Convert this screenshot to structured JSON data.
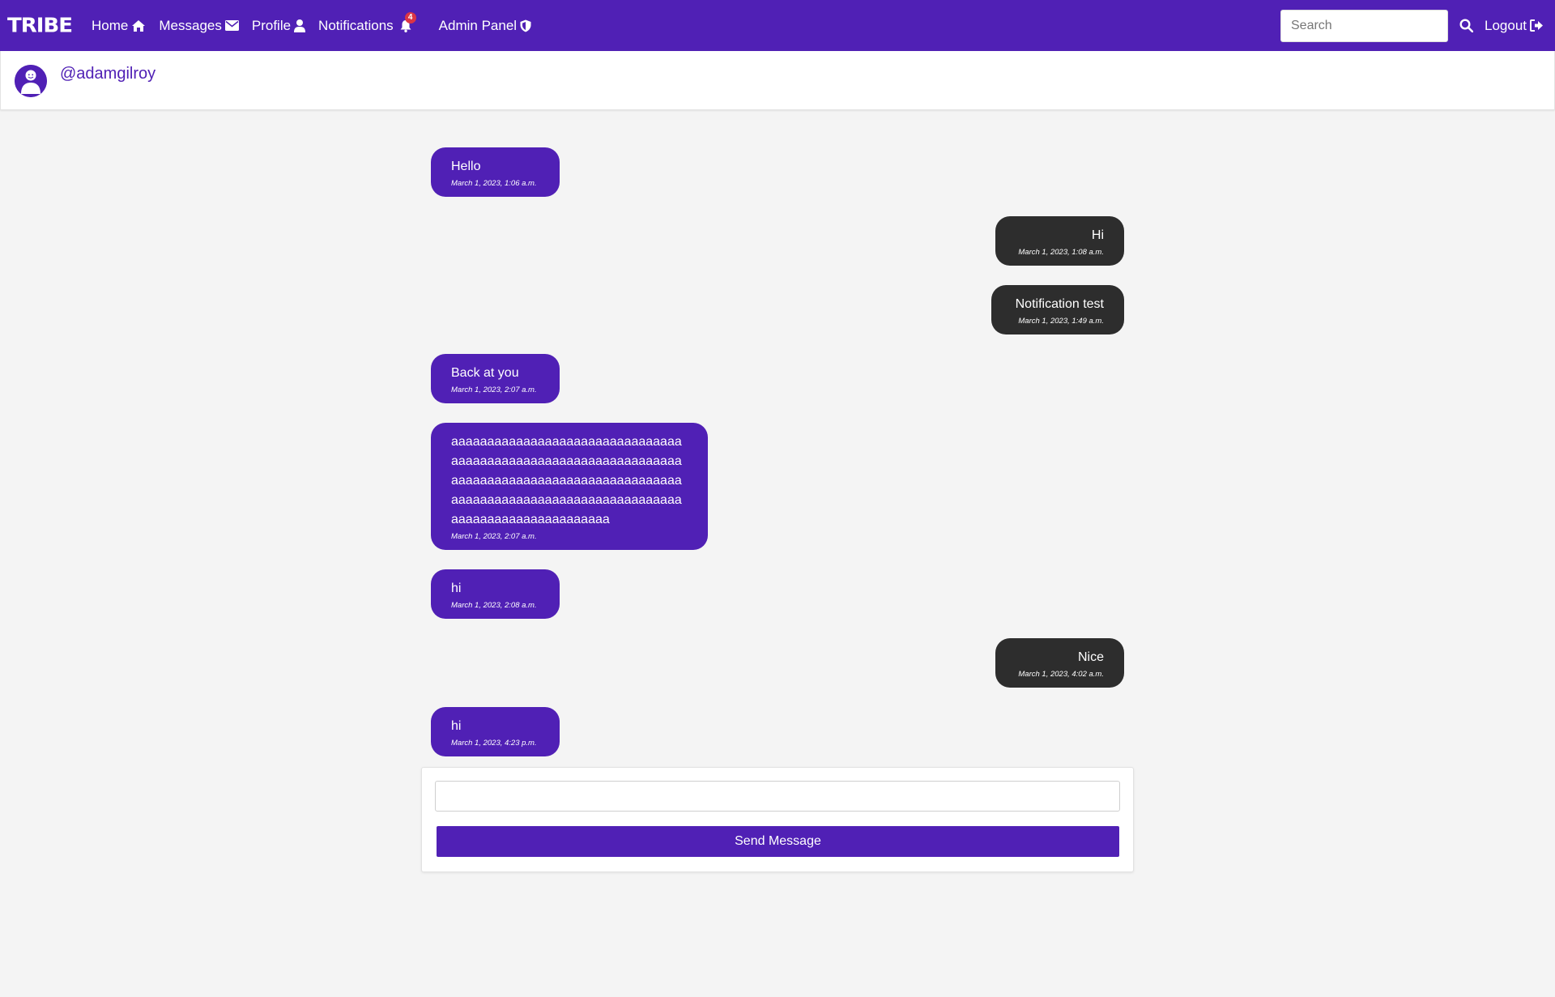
{
  "nav": {
    "brand": "TRIBE",
    "home": "Home",
    "messages": "Messages",
    "profile": "Profile",
    "notifications": "Notifications",
    "notification_count": "4",
    "admin": "Admin Panel",
    "search_placeholder": "Search",
    "logout": "Logout"
  },
  "chat": {
    "username": "@adamgilroy"
  },
  "messages": [
    {
      "direction": "in",
      "text": "Hello",
      "time": "March 1, 2023, 1:06 a.m."
    },
    {
      "direction": "out",
      "text": "Hi",
      "time": "March 1, 2023, 1:08 a.m."
    },
    {
      "direction": "out",
      "text": "Notification test",
      "time": "March 1, 2023, 1:49 a.m."
    },
    {
      "direction": "in",
      "text": "Back at you",
      "time": "March 1, 2023, 2:07 a.m."
    },
    {
      "direction": "in",
      "text": "aaaaaaaaaaaaaaaaaaaaaaaaaaaaaaaaaaaaaaaaaaaaaaaaaaaaaaaaaaaaaaaaaaaaaaaaaaaaaaaaaaaaaaaaaaaaaaaaaaaaaaaaaaaaaaaaaaaaaaaaaaaaaaaaaaaaaaaaaaaaaaaaaaaaaa",
      "time": "March 1, 2023, 2:07 a.m."
    },
    {
      "direction": "in",
      "text": "hi",
      "time": "March 1, 2023, 2:08 a.m."
    },
    {
      "direction": "out",
      "text": "Nice",
      "time": "March 1, 2023, 4:02 a.m."
    },
    {
      "direction": "in",
      "text": "hi",
      "time": "March 1, 2023, 4:23 p.m."
    }
  ],
  "composer": {
    "input_value": "",
    "send_label": "Send Message"
  },
  "colors": {
    "brand": "#5020b5",
    "outgoing_bubble": "#2d2d2d",
    "page_bg": "#f4f4f4",
    "badge": "#dc3545"
  },
  "icons": [
    "home-icon",
    "envelope-icon",
    "user-icon",
    "bell-icon",
    "shield-icon",
    "search-icon",
    "logout-icon"
  ]
}
